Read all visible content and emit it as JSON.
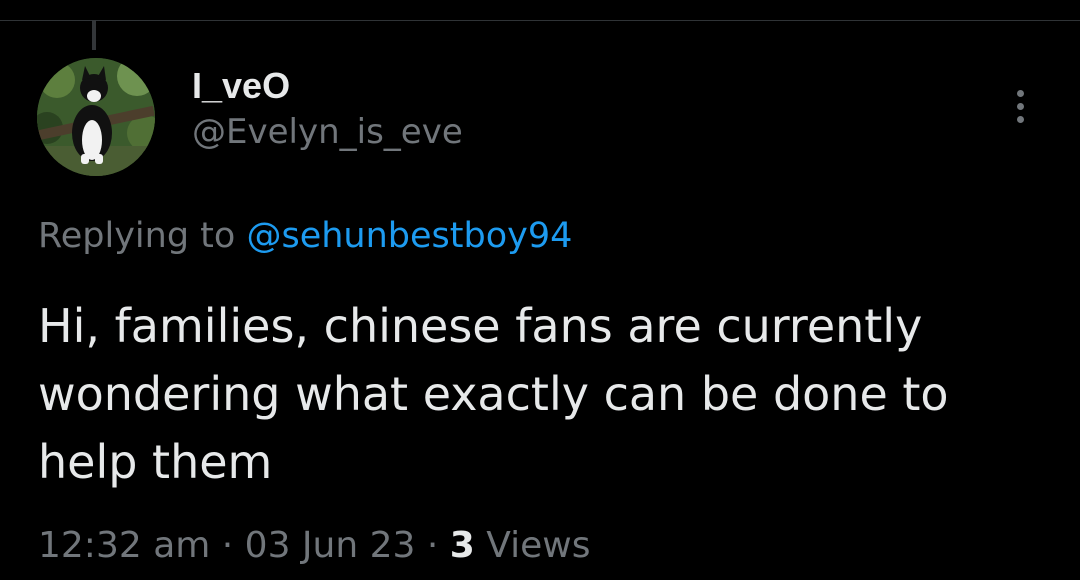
{
  "tweet": {
    "author": {
      "display_name": "I_veO",
      "handle": "@Evelyn_is_eve",
      "avatar_icon": "cat-photo-avatar"
    },
    "reply_prefix": "Replying to ",
    "reply_to": "@sehunbestboy94",
    "text": "Hi, families, chinese fans are currently wondering what exactly can be done to help them",
    "meta": {
      "time": "12:32 am",
      "separator": " · ",
      "date": "03 Jun 23",
      "views_count": "3",
      "views_label": " Views"
    },
    "more_icon": "more-vertical-icon"
  },
  "colors": {
    "background": "#000000",
    "primary_text": "#e7e9ea",
    "secondary_text": "#71767b",
    "link": "#1d9bf0",
    "divider": "#2f3336"
  }
}
